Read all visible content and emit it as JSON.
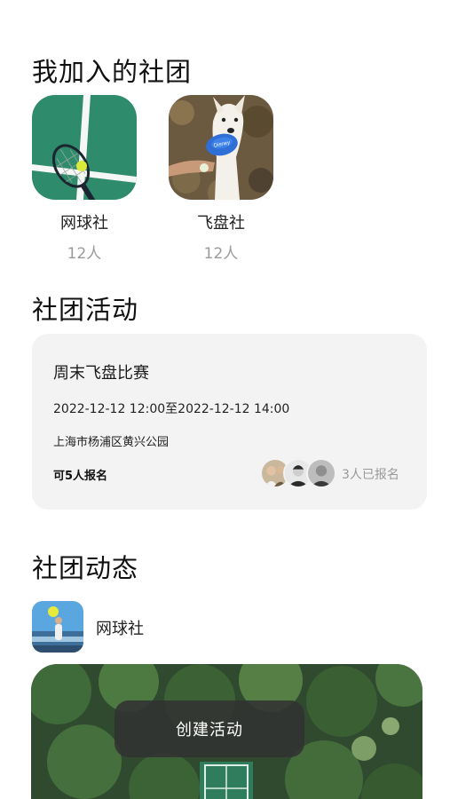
{
  "sections": {
    "joined_title": "我加入的社团",
    "activities_title": "社团活动",
    "feed_title": "社团动态"
  },
  "clubs": [
    {
      "name": "网球社",
      "count": "12人",
      "icon": "tennis-court-racket-photo"
    },
    {
      "name": "飞盘社",
      "count": "12人",
      "icon": "dog-frisbee-photo"
    }
  ],
  "activity": {
    "title": "周末飞盘比赛",
    "time": "2022-12-12 12:00至2022-12-12 14:00",
    "location": "上海市杨浦区黄兴公园",
    "quota": "可5人报名",
    "signed_up": "3人已报名",
    "frisbee_logo": "Disney"
  },
  "feed": {
    "club_name": "网球社",
    "avatar_icon": "tennis-player-photo",
    "image_icon": "aerial-tennis-court-photo"
  },
  "toast": {
    "label": "创建活动"
  },
  "colors": {
    "card_bg": "#f3f3f3",
    "court_green": "#2e8b6b",
    "muted_text": "#9a9a9a",
    "toast_bg": "#323232"
  }
}
